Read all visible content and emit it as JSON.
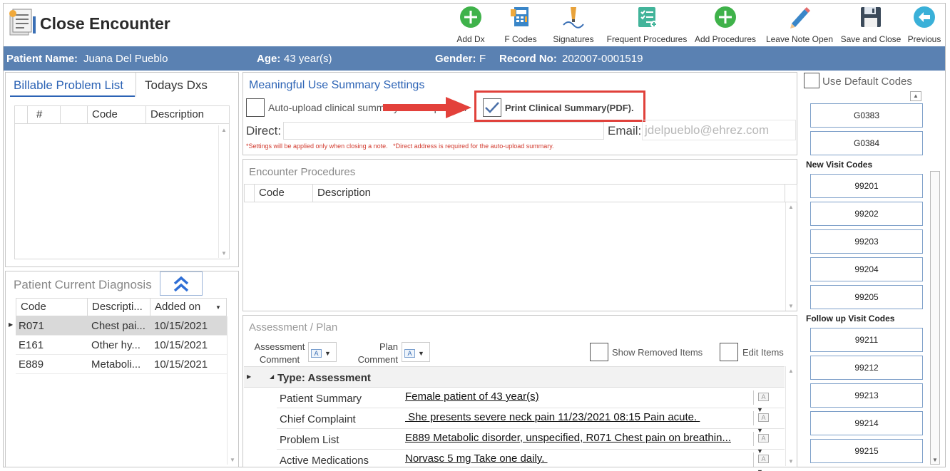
{
  "title": "Close Encounter",
  "toolbar": [
    {
      "label": "Add Dx",
      "icon": "plus-circle-icon"
    },
    {
      "label": "F Codes",
      "icon": "f-codes-icon"
    },
    {
      "label": "Signatures",
      "icon": "signature-pen-icon"
    },
    {
      "label": "Frequent Procedures",
      "icon": "checklist-icon"
    },
    {
      "label": "Add Procedures",
      "icon": "plus-circle-icon"
    },
    {
      "label": "Leave Note Open",
      "icon": "pencil-icon"
    },
    {
      "label": "Save and Close",
      "icon": "floppy-disk-icon"
    },
    {
      "label": "Previous",
      "icon": "arrow-left-icon"
    }
  ],
  "patient": {
    "name_label": "Patient Name:",
    "name": "Juana Del Pueblo",
    "age_label": "Age:",
    "age": "43 year(s)",
    "gender_label": "Gender:",
    "gender": "F",
    "record_label": "Record No:",
    "record": "202007-0001519"
  },
  "left": {
    "tabs": [
      "Billable Problem List",
      "Todays Dxs"
    ],
    "problem_columns": [
      "#",
      "Code",
      "Description"
    ],
    "diagnosis_title": "Patient Current Diagnosis",
    "diagnosis_columns": [
      "Code",
      "Descripti...",
      "Added on"
    ],
    "diagnosis_rows": [
      {
        "code": "R071",
        "desc": "Chest pai...",
        "date": "10/15/2021"
      },
      {
        "code": "E161",
        "desc": "Other hy...",
        "date": "10/15/2021"
      },
      {
        "code": "E889",
        "desc": "Metaboli...",
        "date": "10/15/2021"
      }
    ]
  },
  "mu": {
    "title": "Meaningful Use Summary Settings",
    "auto_upload_label": "Auto-upload clinical summary for this patient.",
    "print_label": "Print Clinical Summary(PDF).",
    "print_checked": true,
    "direct_label": "Direct:",
    "direct_value": "",
    "email_label": "Email:",
    "email_value": "jdelpueblo@ehrez.com",
    "note": "*Settings will be applied only when closing a note.   *Direct address is required for the auto-upload summary."
  },
  "procedures": {
    "title": "Encounter Procedures",
    "columns": [
      "Code",
      "Description"
    ]
  },
  "assessment": {
    "title": "Assessment / Plan",
    "assessment_comment_label_1": "Assessment",
    "assessment_comment_label_2": "Comment",
    "plan_comment_label_1": "Plan",
    "plan_comment_label_2": "Comment",
    "show_removed_label": "Show Removed Items",
    "edit_items_label": "Edit Items",
    "group_label": "Type: Assessment",
    "rows": [
      {
        "label": "Patient Summary",
        "value": "Female patient of 43 year(s)"
      },
      {
        "label": "Chief Complaint",
        "value": " She presents severe neck pain 11/23/2021 08:15 Pain acute. "
      },
      {
        "label": "Problem List",
        "value": "E889 Metabolic disorder, unspecified, R071 Chest pain on breathin..."
      },
      {
        "label": "Active Medications",
        "value": "Norvasc 5 mg Take one daily. "
      }
    ]
  },
  "codes": {
    "use_default_label": "Use Default Codes",
    "top_codes": [
      "G0383",
      "G0384"
    ],
    "new_visit_label": "New Visit Codes",
    "new_visit_codes": [
      "99201",
      "99202",
      "99203",
      "99204",
      "99205"
    ],
    "follow_up_label": "Follow up Visit Codes",
    "follow_up_codes": [
      "99211",
      "99212",
      "99213",
      "99214",
      "99215"
    ]
  },
  "colors": {
    "banner": "#5a81b2",
    "highlight": "#e0413b",
    "accent_blue": "#2c63b5"
  }
}
